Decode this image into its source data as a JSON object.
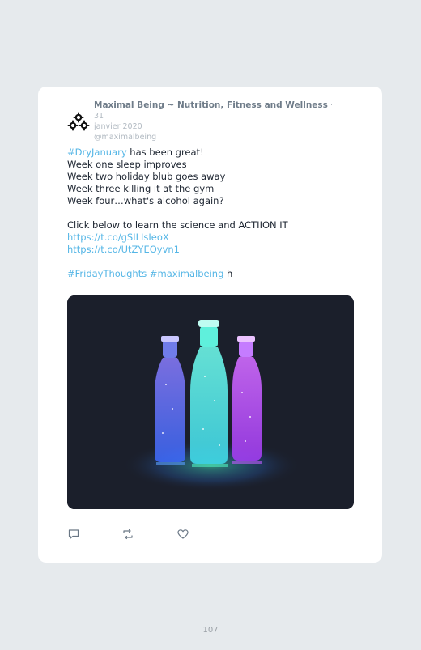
{
  "tweet": {
    "author_name": "Maximal Being ~ Nutrition, Fitness and Wellness",
    "separator": " · ",
    "date_day": "31",
    "date_rest": "janvier 2020",
    "handle": "@maximalbeing",
    "lines": {
      "hashtag_dry": "#DryJanuary",
      "line1_rest": " has been great!",
      "line2": "Week one sleep improves",
      "line3": "Week two holiday blub goes away",
      "line4": "Week three killing it at the gym",
      "line5": "Week four…what's alcohol again?",
      "line6": "Click below to learn the science and ACTIION IT",
      "link1": "https://t.co/gSILIsIeoX",
      "link2": "https://t.co/UtZYEOyvn1",
      "hashtag_friday": "#FridayThoughts",
      "hashtag_maximal": "#maximalbeing",
      "trailing": " h"
    },
    "media_alt_icon": "glowing-bottles-image",
    "actions": {
      "reply_icon": "reply-icon",
      "retweet_icon": "retweet-icon",
      "like_icon": "heart-icon"
    }
  },
  "page": {
    "number": "107"
  },
  "colors": {
    "background": "#e6eaed",
    "card": "#ffffff",
    "link": "#55b6e6",
    "text": "#1c2430",
    "muted": "#b2bac2"
  }
}
